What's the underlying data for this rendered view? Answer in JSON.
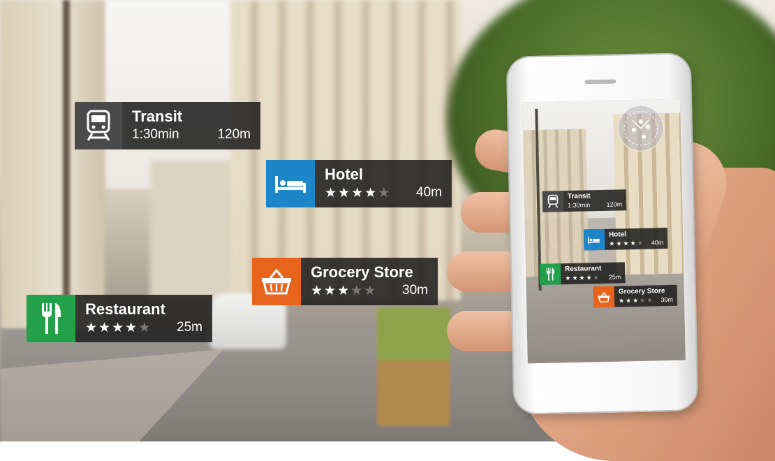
{
  "colors": {
    "transit": "#4a4a4a",
    "hotel": "#1d86c8",
    "grocery": "#e8641d",
    "restaurant": "#23a04a",
    "card_bg": "#202020"
  },
  "overlays": {
    "transit": {
      "icon": "train-icon",
      "title": "Transit",
      "time": "1:30min",
      "distance": "120m"
    },
    "hotel": {
      "icon": "bed-icon",
      "title": "Hotel",
      "rating": 4,
      "rating_max": 5,
      "distance": "40m"
    },
    "grocery": {
      "icon": "basket-icon",
      "title": "Grocery Store",
      "rating": 3,
      "rating_max": 5,
      "distance": "30m"
    },
    "restaurant": {
      "icon": "fork-knife-icon",
      "title": "Restaurant",
      "rating": 4,
      "rating_max": 5,
      "distance": "25m"
    }
  },
  "phone_screen": {
    "transit": {
      "title": "Transit",
      "time": "1:30min",
      "distance": "120m"
    },
    "hotel": {
      "title": "Hotel",
      "rating": 4,
      "distance": "40m"
    },
    "restaurant": {
      "title": "Restaurant",
      "rating": 4,
      "distance": "25m"
    },
    "grocery": {
      "title": "Grocery Store",
      "rating": 3,
      "distance": "30m"
    }
  }
}
